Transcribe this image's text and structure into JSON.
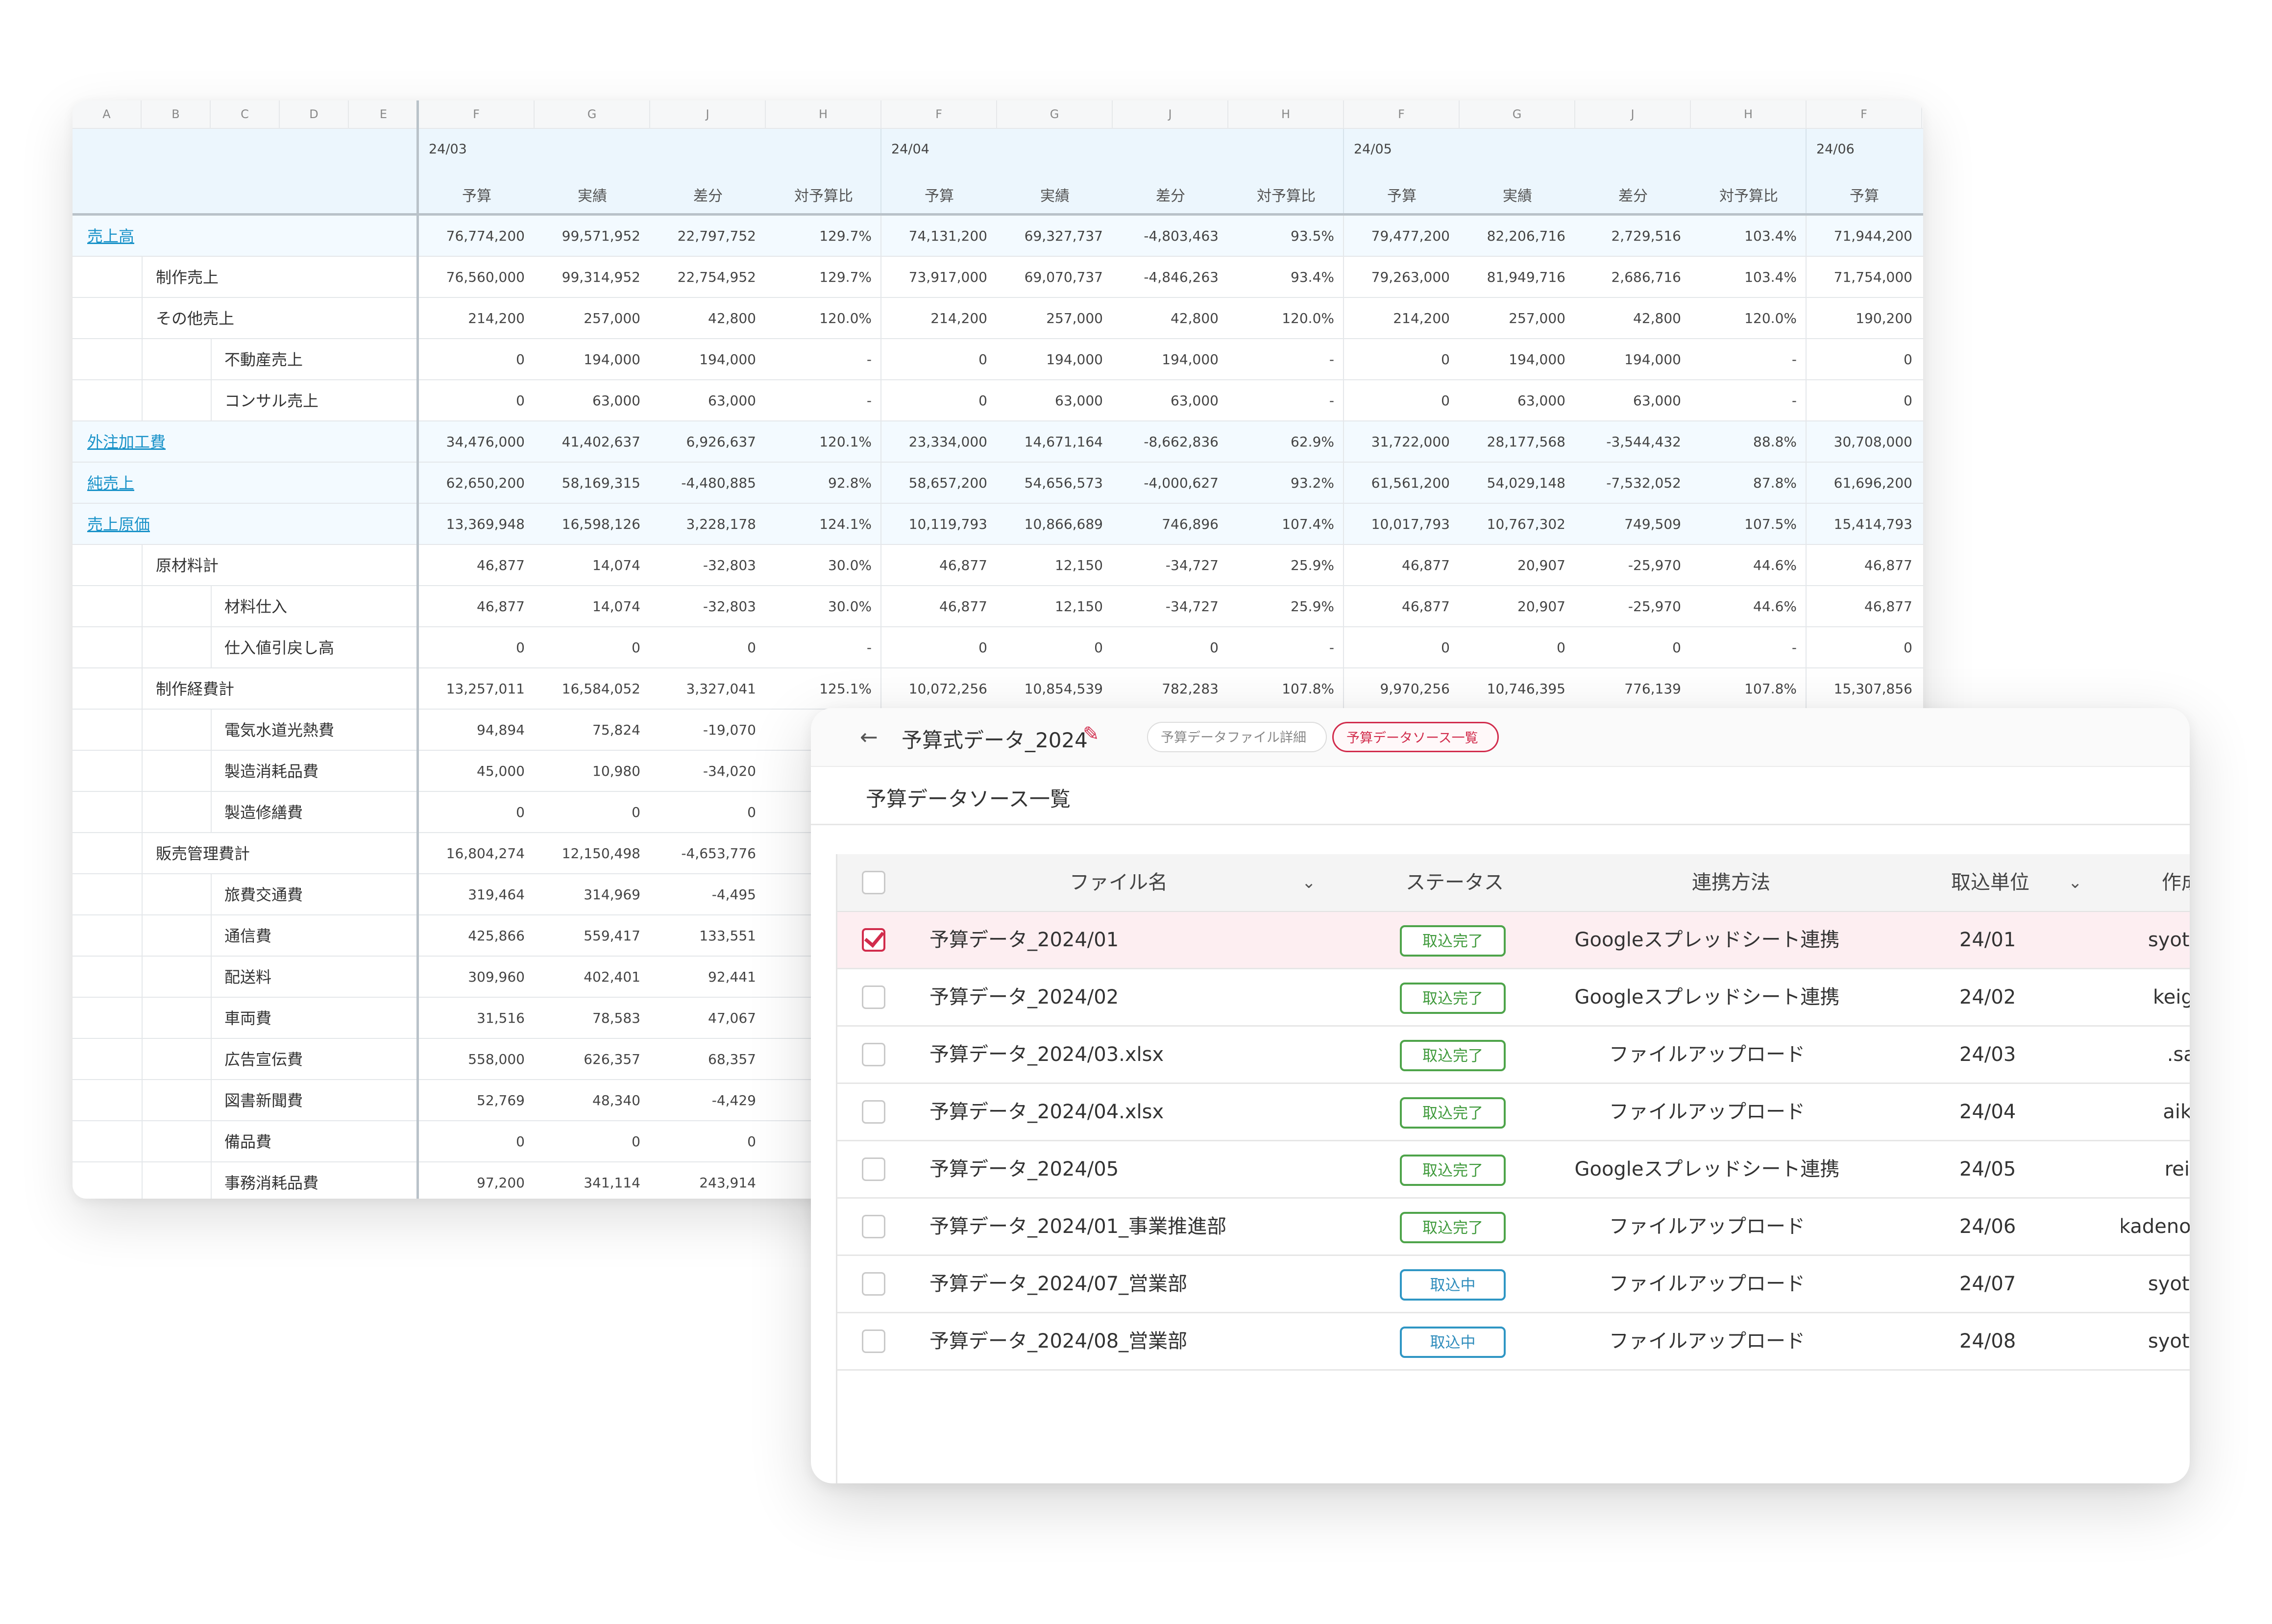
{
  "sheet": {
    "column_letters": [
      "A",
      "B",
      "C",
      "D",
      "E",
      "F",
      "G",
      "J",
      "H",
      "F",
      "G",
      "J",
      "H",
      "F",
      "G",
      "J",
      "H",
      "F"
    ],
    "periods": [
      "24/03",
      "24/04",
      "24/05",
      "24/06"
    ],
    "header_cols": [
      "予算",
      "実績",
      "差分",
      "対予算比",
      "予算",
      "実績",
      "差分",
      "対予算比",
      "予算",
      "実績",
      "差分",
      "対予算比",
      "予算"
    ],
    "rows": [
      {
        "label": "売上高",
        "level": 0,
        "link": true,
        "values": [
          "76,774,200",
          "99,571,952",
          "22,797,752",
          "129.7%",
          "74,131,200",
          "69,327,737",
          "-4,803,463",
          "93.5%",
          "79,477,200",
          "82,206,716",
          "2,729,516",
          "103.4%",
          "71,944,200"
        ]
      },
      {
        "label": "制作売上",
        "level": 1,
        "values": [
          "76,560,000",
          "99,314,952",
          "22,754,952",
          "129.7%",
          "73,917,000",
          "69,070,737",
          "-4,846,263",
          "93.4%",
          "79,263,000",
          "81,949,716",
          "2,686,716",
          "103.4%",
          "71,754,000"
        ]
      },
      {
        "label": "その他売上",
        "level": 1,
        "values": [
          "214,200",
          "257,000",
          "42,800",
          "120.0%",
          "214,200",
          "257,000",
          "42,800",
          "120.0%",
          "214,200",
          "257,000",
          "42,800",
          "120.0%",
          "190,200"
        ]
      },
      {
        "label": "不動産売上",
        "level": 2,
        "values": [
          "0",
          "194,000",
          "194,000",
          "-",
          "0",
          "194,000",
          "194,000",
          "-",
          "0",
          "194,000",
          "194,000",
          "-",
          "0"
        ]
      },
      {
        "label": "コンサル売上",
        "level": 2,
        "values": [
          "0",
          "63,000",
          "63,000",
          "-",
          "0",
          "63,000",
          "63,000",
          "-",
          "0",
          "63,000",
          "63,000",
          "-",
          "0"
        ]
      },
      {
        "label": "外注加工費",
        "level": 0,
        "link": true,
        "values": [
          "34,476,000",
          "41,402,637",
          "6,926,637",
          "120.1%",
          "23,334,000",
          "14,671,164",
          "-8,662,836",
          "62.9%",
          "31,722,000",
          "28,177,568",
          "-3,544,432",
          "88.8%",
          "30,708,000"
        ]
      },
      {
        "label": "純売上",
        "level": 0,
        "link": true,
        "values": [
          "62,650,200",
          "58,169,315",
          "-4,480,885",
          "92.8%",
          "58,657,200",
          "54,656,573",
          "-4,000,627",
          "93.2%",
          "61,561,200",
          "54,029,148",
          "-7,532,052",
          "87.8%",
          "61,696,200"
        ]
      },
      {
        "label": "売上原価",
        "level": 0,
        "link": true,
        "values": [
          "13,369,948",
          "16,598,126",
          "3,228,178",
          "124.1%",
          "10,119,793",
          "10,866,689",
          "746,896",
          "107.4%",
          "10,017,793",
          "10,767,302",
          "749,509",
          "107.5%",
          "15,414,793"
        ]
      },
      {
        "label": "原材料計",
        "level": 1,
        "values": [
          "46,877",
          "14,074",
          "-32,803",
          "30.0%",
          "46,877",
          "12,150",
          "-34,727",
          "25.9%",
          "46,877",
          "20,907",
          "-25,970",
          "44.6%",
          "46,877"
        ]
      },
      {
        "label": "材料仕入",
        "level": 2,
        "values": [
          "46,877",
          "14,074",
          "-32,803",
          "30.0%",
          "46,877",
          "12,150",
          "-34,727",
          "25.9%",
          "46,877",
          "20,907",
          "-25,970",
          "44.6%",
          "46,877"
        ]
      },
      {
        "label": "仕入値引戻し高",
        "level": 2,
        "values": [
          "0",
          "0",
          "0",
          "-",
          "0",
          "0",
          "0",
          "-",
          "0",
          "0",
          "0",
          "-",
          "0"
        ]
      },
      {
        "label": "制作経費計",
        "level": 1,
        "values": [
          "13,257,011",
          "16,584,052",
          "3,327,041",
          "125.1%",
          "10,072,256",
          "10,854,539",
          "782,283",
          "107.8%",
          "9,970,256",
          "10,746,395",
          "776,139",
          "107.8%",
          "15,307,856"
        ]
      },
      {
        "label": "電気水道光熱費",
        "level": 2,
        "values": [
          "94,894",
          "75,824",
          "-19,070"
        ]
      },
      {
        "label": "製造消耗品費",
        "level": 2,
        "values": [
          "45,000",
          "10,980",
          "-34,020"
        ]
      },
      {
        "label": "製造修繕費",
        "level": 2,
        "values": [
          "0",
          "0",
          "0"
        ]
      },
      {
        "label": "販売管理費計",
        "level": 1,
        "values": [
          "16,804,274",
          "12,150,498",
          "-4,653,776"
        ]
      },
      {
        "label": "旅費交通費",
        "level": 2,
        "values": [
          "319,464",
          "314,969",
          "-4,495"
        ]
      },
      {
        "label": "通信費",
        "level": 2,
        "values": [
          "425,866",
          "559,417",
          "133,551"
        ]
      },
      {
        "label": "配送料",
        "level": 2,
        "values": [
          "309,960",
          "402,401",
          "92,441"
        ]
      },
      {
        "label": "車両費",
        "level": 2,
        "values": [
          "31,516",
          "78,583",
          "47,067"
        ]
      },
      {
        "label": "広告宣伝費",
        "level": 2,
        "values": [
          "558,000",
          "626,357",
          "68,357"
        ]
      },
      {
        "label": "図書新聞費",
        "level": 2,
        "values": [
          "52,769",
          "48,340",
          "-4,429"
        ]
      },
      {
        "label": "備品費",
        "level": 2,
        "values": [
          "0",
          "0",
          "0"
        ]
      },
      {
        "label": "事務消耗品費",
        "level": 2,
        "values": [
          "97,200",
          "341,114",
          "243,914"
        ]
      }
    ]
  },
  "panel": {
    "back_icon": "arrow-left-icon",
    "title": "予算式データ_2024",
    "edit_icon": "pencil-icon",
    "tabs": [
      "予算データファイル詳細",
      "予算データソース一覧"
    ],
    "active_tab": 1,
    "subtitle": "予算データソース一覧",
    "columns": {
      "file": "ファイル名",
      "status": "ステータス",
      "method": "連携方法",
      "unit": "取込単位",
      "creator": "作成"
    },
    "rows": [
      {
        "checked": true,
        "file": "予算データ_2024/01",
        "status": "取込完了",
        "state": "done",
        "method": "Googleスプレッドシート連携",
        "unit": "24/01",
        "creator": "syota.k"
      },
      {
        "checked": false,
        "file": "予算データ_2024/02",
        "status": "取込完了",
        "state": "done",
        "method": "Googleスプレッドシート連携",
        "unit": "24/02",
        "creator": "keigo.t"
      },
      {
        "checked": false,
        "file": "予算データ_2024/03.xlsx",
        "status": "取込完了",
        "state": "done",
        "method": "ファイルアップロード",
        "unit": "24/03",
        "creator": "sayo."
      },
      {
        "checked": false,
        "file": "予算データ_2024/04.xlsx",
        "status": "取込完了",
        "state": "done",
        "method": "ファイルアップロード",
        "unit": "24/04",
        "creator": "aiko.s"
      },
      {
        "checked": false,
        "file": "予算データ_2024/05",
        "status": "取込完了",
        "state": "done",
        "method": "Googleスプレッドシート連携",
        "unit": "24/05",
        "creator": "rei.ku"
      },
      {
        "checked": false,
        "file": "予算データ_2024/01_事業推進部",
        "status": "取込完了",
        "state": "done",
        "method": "ファイルアップロード",
        "unit": "24/06",
        "creator": "kadenokoj"
      },
      {
        "checked": false,
        "file": "予算データ_2024/07_営業部",
        "status": "取込中",
        "state": "prog",
        "method": "ファイルアップロード",
        "unit": "24/07",
        "creator": "syota.k"
      },
      {
        "checked": false,
        "file": "予算データ_2024/08_営業部",
        "status": "取込中",
        "state": "prog",
        "method": "ファイルアップロード",
        "unit": "24/08",
        "creator": "syota.k"
      }
    ],
    "colors": {
      "accent": "#d12c4c",
      "done": "#4ea44a",
      "progress": "#2f96c4",
      "link": "#1b93c9"
    }
  }
}
